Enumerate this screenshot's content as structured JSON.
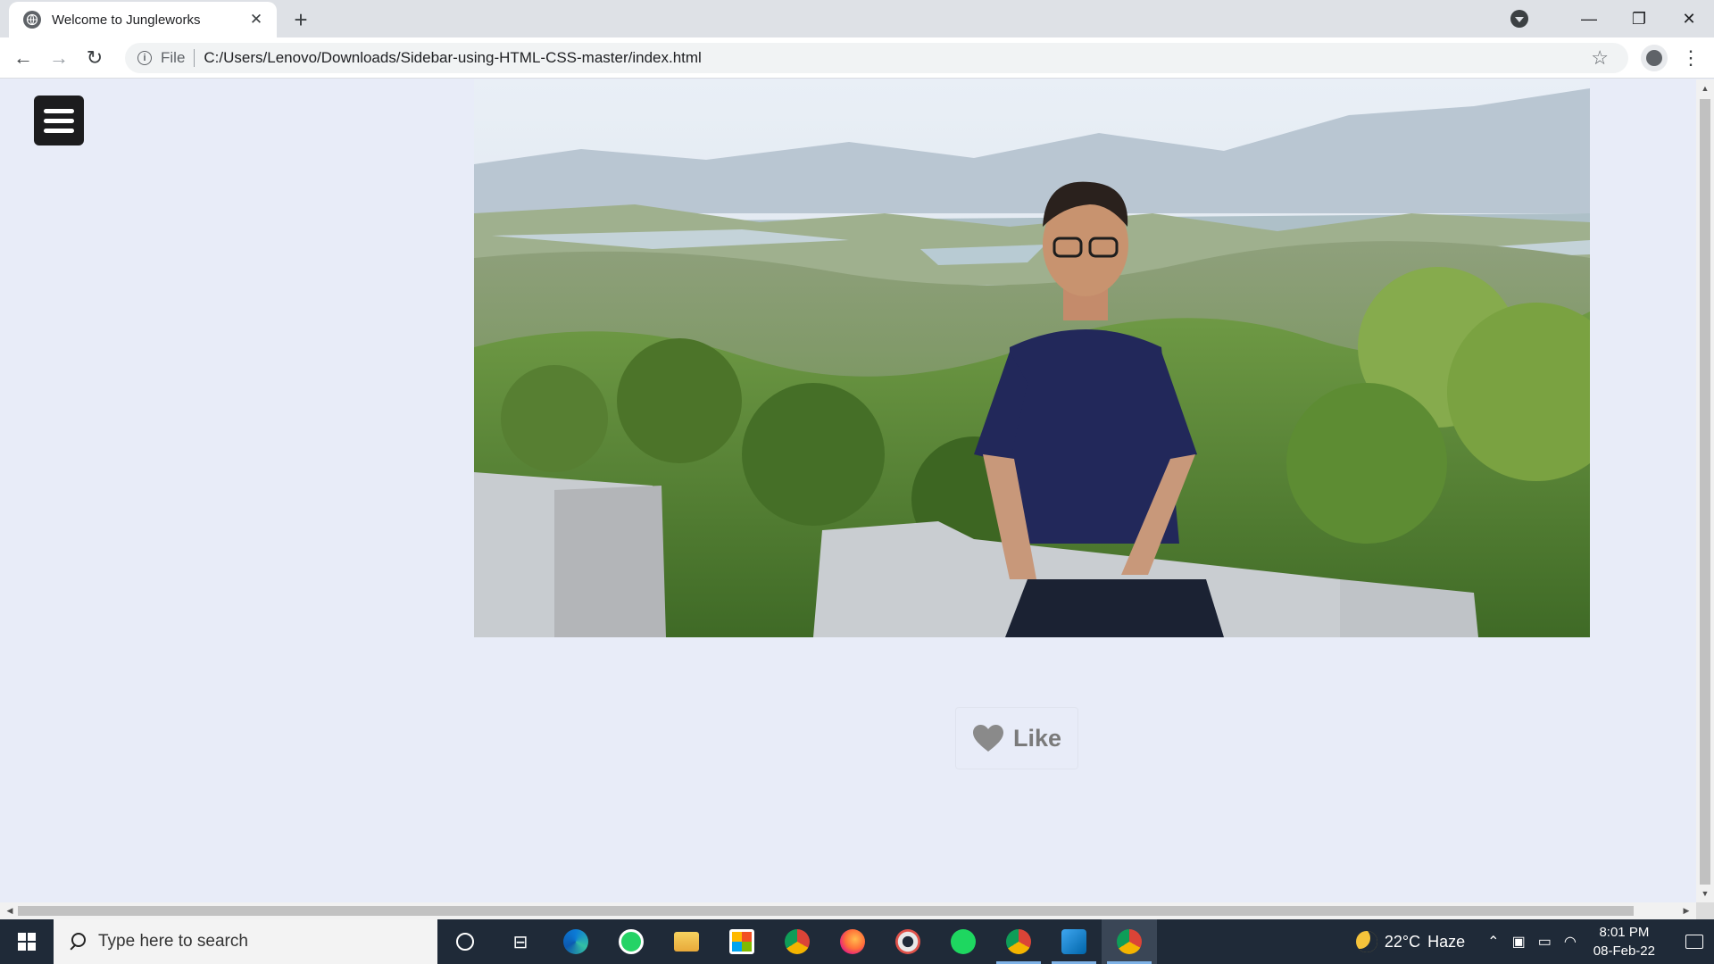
{
  "browser": {
    "tab_title": "Welcome to Jungleworks",
    "new_tab_label": "+",
    "scheme_label": "File",
    "url": "C:/Users/Lenovo/Downloads/Sidebar-using-HTML-CSS-master/index.html"
  },
  "page": {
    "like_label": "Like",
    "colors": {
      "background": "#e8ecf8",
      "menu_button": "#1c1c1e",
      "heart": "#8a8a8a"
    }
  },
  "taskbar": {
    "search_placeholder": "Type here to search",
    "apps": [
      "cortana-icon",
      "task-view-icon",
      "edge-icon",
      "whatsapp-icon",
      "file-explorer-icon",
      "microsoft-store-icon",
      "chrome-icon",
      "firefox-icon",
      "media-app-icon",
      "spotify-icon",
      "chrome-profile-icon",
      "vscode-icon",
      "chrome-active-icon"
    ],
    "weather_temp": "22°C",
    "weather_condition": "Haze",
    "time": "8:01 PM",
    "date": "08-Feb-22"
  }
}
